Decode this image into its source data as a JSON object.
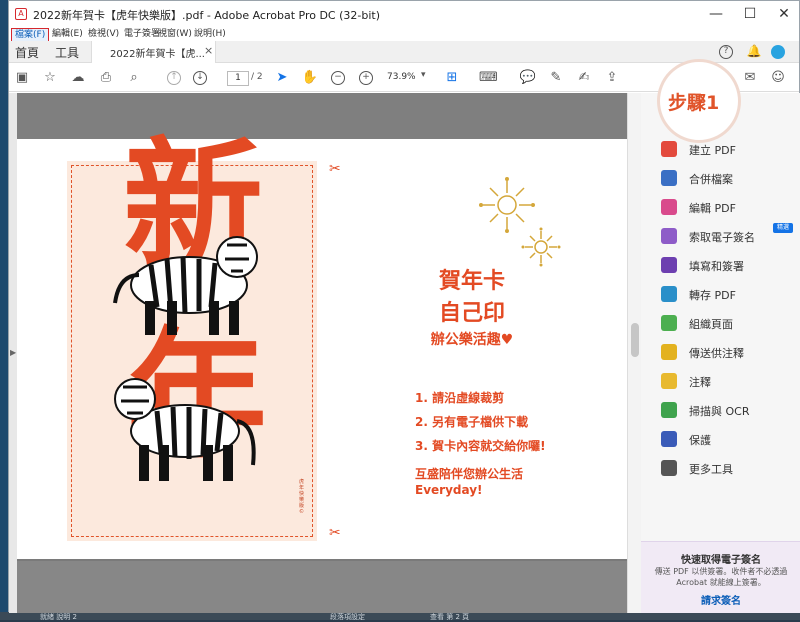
{
  "window": {
    "title": "2022新年賀卡【虎年快樂版】.pdf - Adobe Acrobat Pro DC (32-bit)",
    "minimize": "—",
    "maximize": "☐",
    "close": "✕"
  },
  "menu": [
    "檔案(F)",
    "編輯(E)",
    "檢視(V)",
    "電子簽署",
    "視窗(W)",
    "說明(H)"
  ],
  "tabs": {
    "home": "首頁",
    "tools": "工具",
    "document": "2022新年賀卡【虎...",
    "close": "×"
  },
  "toolbar": {
    "page_current": "1",
    "page_total": "/ 2",
    "zoom": "73.9%"
  },
  "card": {
    "char_top": "新",
    "char_bottom": "年",
    "vertical_note": "虎年快樂版",
    "vertical_note_mark": "©"
  },
  "content": {
    "headline1": "賀年卡",
    "headline2": "自己印",
    "headline3": "辦公樂活趣♥",
    "steps": [
      "1. 請沿虛線裁剪",
      "2. 另有電子檔供下載",
      "3. 賀卡內容就交給你囉!"
    ],
    "footer1": "互盛陪伴您辦公生活",
    "footer2": "Everyday!"
  },
  "sidebar": {
    "badge": "步驟1",
    "new_label": "精選",
    "items": [
      {
        "label": "建立 PDF",
        "color": "#e34a3d"
      },
      {
        "label": "合併檔案",
        "color": "#3a6fc4"
      },
      {
        "label": "編輯 PDF",
        "color": "#d94a8c"
      },
      {
        "label": "索取電子簽名",
        "color": "#8e5cc8"
      },
      {
        "label": "填寫和簽署",
        "color": "#6d3fb0"
      },
      {
        "label": "轉存 PDF",
        "color": "#2a8fc9"
      },
      {
        "label": "組織頁面",
        "color": "#4caf50"
      },
      {
        "label": "傳送供注釋",
        "color": "#e3b21f"
      },
      {
        "label": "注釋",
        "color": "#e8b92e"
      },
      {
        "label": "掃描與 OCR",
        "color": "#3fa34d"
      },
      {
        "label": "保護",
        "color": "#3a5bb8"
      },
      {
        "label": "更多工具",
        "color": "#555555"
      }
    ],
    "promo": {
      "title": "快速取得電子簽名",
      "desc": "傳送 PDF 以供簽署。收件者不必透過 Acrobat 就能線上簽署。",
      "link": "請求簽名"
    }
  },
  "taskbar": {
    "left": "就緒 說明 2",
    "mid": "段落項設定",
    "right": "查看 第 2 頁"
  },
  "colors": {
    "accent": "#e34a23",
    "link": "#0d5fb8"
  }
}
